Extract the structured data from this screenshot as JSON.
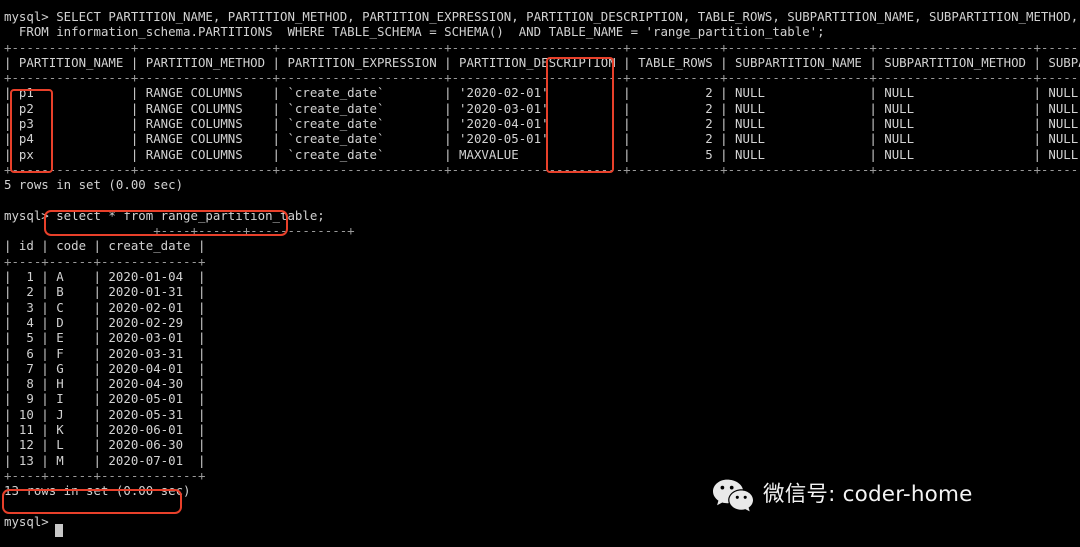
{
  "terminal": {
    "prompt": "mysql>",
    "colors": {
      "background": "#000000",
      "foreground": "#d2d2d2",
      "highlight": "#e8402a",
      "watermark_text": "#f4f4f4"
    },
    "lines": [
      "mysql> SELECT PARTITION_NAME, PARTITION_METHOD, PARTITION_EXPRESSION, PARTITION_DESCRIPTION, TABLE_ROWS, SUBPARTITION_NAME, SUBPARTITION_METHOD, SUBPARTITION_EXPRESSION",
      "  FROM information_schema.PARTITIONS  WHERE TABLE_SCHEMA = SCHEMA()  AND TABLE_NAME = 'range_partition_table';",
      "+----------------+------------------+----------------------+-----------------------+------------+-------------------+---------------------+-------------------------+",
      "| PARTITION_NAME | PARTITION_METHOD | PARTITION_EXPRESSION | PARTITION_DESCRIPTION | TABLE_ROWS | SUBPARTITION_NAME | SUBPARTITION_METHOD | SUBPARTITION_EXPRESSION |",
      "+----------------+------------------+----------------------+-----------------------+------------+-------------------+---------------------+-------------------------+",
      "| p1             | RANGE COLUMNS    | `create_date`        | '2020-02-01'          |          2 | NULL              | NULL                | NULL                    |",
      "| p2             | RANGE COLUMNS    | `create_date`        | '2020-03-01'          |          2 | NULL              | NULL                | NULL                    |",
      "| p3             | RANGE COLUMNS    | `create_date`        | '2020-04-01'          |          2 | NULL              | NULL                | NULL                    |",
      "| p4             | RANGE COLUMNS    | `create_date`        | '2020-05-01'          |          2 | NULL              | NULL                | NULL                    |",
      "| px             | RANGE COLUMNS    | `create_date`        | MAXVALUE              |          5 | NULL              | NULL                | NULL                    |",
      "+----------------+------------------+----------------------+-----------------------+------------+-------------------+---------------------+-------------------------+",
      "5 rows in set (0.00 sec)",
      "",
      "mysql> select * from range_partition_table;",
      "                    +----+------+-------------+",
      "| id | code | create_date |",
      "+----+------+-------------+",
      "|  1 | A    | 2020-01-04  |",
      "|  2 | B    | 2020-01-31  |",
      "|  3 | C    | 2020-02-01  |",
      "|  4 | D    | 2020-02-29  |",
      "|  5 | E    | 2020-03-01  |",
      "|  6 | F    | 2020-03-31  |",
      "|  7 | G    | 2020-04-01  |",
      "|  8 | H    | 2020-04-30  |",
      "|  9 | I    | 2020-05-01  |",
      "| 10 | J    | 2020-05-31  |",
      "| 11 | K    | 2020-06-01  |",
      "| 12 | L    | 2020-06-30  |",
      "| 13 | M    | 2020-07-01  |",
      "+----+------+-------------+",
      "13 rows in set (0.00 sec)",
      "",
      "mysql> "
    ],
    "queries": [
      {
        "name": "partitions-metadata-query",
        "text": "SELECT PARTITION_NAME, PARTITION_METHOD, PARTITION_EXPRESSION, PARTITION_DESCRIPTION, TABLE_ROWS, SUBPARTITION_NAME, SUBPARTITION_METHOD, SUBPARTITION_EXPRESSION FROM information_schema.PARTITIONS WHERE TABLE_SCHEMA = SCHEMA() AND TABLE_NAME = 'range_partition_table';"
      },
      {
        "name": "select-all-rows-query",
        "text": "select * from range_partition_table;"
      }
    ],
    "result_partitions": {
      "columns": [
        "PARTITION_NAME",
        "PARTITION_METHOD",
        "PARTITION_EXPRESSION",
        "PARTITION_DESCRIPTION",
        "TABLE_ROWS",
        "SUBPARTITION_NAME",
        "SUBPARTITION_METHOD",
        "SUBPARTITION_EXPRESSION"
      ],
      "rows": [
        [
          "p1",
          "RANGE COLUMNS",
          "`create_date`",
          "'2020-02-01'",
          "2",
          "NULL",
          "NULL",
          "NULL"
        ],
        [
          "p2",
          "RANGE COLUMNS",
          "`create_date`",
          "'2020-03-01'",
          "2",
          "NULL",
          "NULL",
          "NULL"
        ],
        [
          "p3",
          "RANGE COLUMNS",
          "`create_date`",
          "'2020-04-01'",
          "2",
          "NULL",
          "NULL",
          "NULL"
        ],
        [
          "p4",
          "RANGE COLUMNS",
          "`create_date`",
          "'2020-05-01'",
          "2",
          "NULL",
          "NULL",
          "NULL"
        ],
        [
          "px",
          "RANGE COLUMNS",
          "`create_date`",
          "MAXVALUE",
          "5",
          "NULL",
          "NULL",
          "NULL"
        ]
      ],
      "status": "5 rows in set (0.00 sec)"
    },
    "result_table": {
      "columns": [
        "id",
        "code",
        "create_date"
      ],
      "rows": [
        [
          "1",
          "A",
          "2020-01-04"
        ],
        [
          "2",
          "B",
          "2020-01-31"
        ],
        [
          "3",
          "C",
          "2020-02-01"
        ],
        [
          "4",
          "D",
          "2020-02-29"
        ],
        [
          "5",
          "E",
          "2020-03-01"
        ],
        [
          "6",
          "F",
          "2020-03-31"
        ],
        [
          "7",
          "G",
          "2020-04-01"
        ],
        [
          "8",
          "H",
          "2020-04-30"
        ],
        [
          "9",
          "I",
          "2020-05-01"
        ],
        [
          "10",
          "J",
          "2020-05-31"
        ],
        [
          "11",
          "K",
          "2020-06-01"
        ],
        [
          "12",
          "L",
          "2020-06-30"
        ],
        [
          "13",
          "M",
          "2020-07-01"
        ]
      ],
      "status": "13 rows in set (0.00 sec)"
    }
  },
  "watermark": {
    "icon": "wechat-icon",
    "text": "微信号: coder-home"
  }
}
